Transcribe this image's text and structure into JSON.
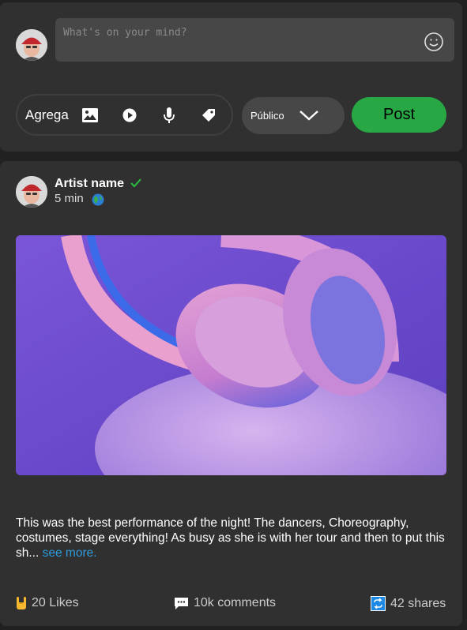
{
  "composer": {
    "placeholder": "What's on your mind?",
    "toolbar_label": "Agrega",
    "audience": "Público",
    "post_button": "Post"
  },
  "post": {
    "author": "Artist name",
    "time": "5 min",
    "text": "This was the best performance of the night! The dancers, Choreography, costumes, stage everything! As busy as she is with her tour and then to put this sh...",
    "see_more": "see more.",
    "likes": "20 Likes",
    "comments": "10k comments",
    "shares": "42 shares"
  },
  "colors": {
    "accent_green": "#28a745",
    "link_blue": "#2d9cdb"
  },
  "icons": [
    "smiley-icon",
    "image-icon",
    "play-icon",
    "microphone-icon",
    "tag-icon",
    "chevron-down-icon",
    "verified-check-icon",
    "globe-icon",
    "rock-hand-icon",
    "comment-icon",
    "share-icon"
  ]
}
